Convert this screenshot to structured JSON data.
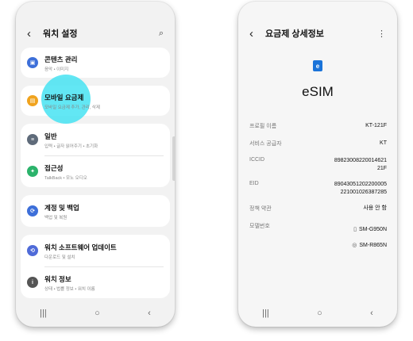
{
  "left_phone": {
    "header": {
      "title": "워치 설정"
    },
    "items": [
      {
        "title": "콘텐츠 관리",
        "subtitle": "음악 • 이미지",
        "color": "#3d6fd9",
        "glyph": "▣"
      },
      {
        "title": "모바일 요금제",
        "subtitle": "모바일 요금제 추가, 관리, 삭제",
        "color": "#f0a31e",
        "glyph": "▤"
      },
      {
        "title": "일반",
        "subtitle": "입력 • 글자 읽어주기 • 초기화",
        "color": "#5f6b7a",
        "glyph": "≡"
      },
      {
        "title": "접근성",
        "subtitle": "TalkBack • 모노 오디오",
        "color": "#2bb36b",
        "glyph": "✦"
      },
      {
        "title": "계정 및 백업",
        "subtitle": "백업 및 복원",
        "color": "#3d6fd9",
        "glyph": "⟳"
      },
      {
        "title": "워치 소프트웨어 업데이트",
        "subtitle": "다운로드 및 설치",
        "color": "#4f6bd8",
        "glyph": "⟲"
      },
      {
        "title": "워치 정보",
        "subtitle": "상태 • 법률 정보 • 워치 이름",
        "color": "#555555",
        "glyph": "ⓘ"
      }
    ]
  },
  "right_phone": {
    "header": {
      "title": "요금제 상세정보"
    },
    "esim_icon_letter": "e",
    "esim_title": "eSIM",
    "rows": [
      {
        "label": "프로필 이름",
        "value": "KT-121F"
      },
      {
        "label": "서비스 공급자",
        "value": "KT"
      },
      {
        "label": "ICCID",
        "value_line1": "89823008220014621",
        "value_line2": "21F"
      },
      {
        "label": "EID",
        "value_line1": "89043051202200005",
        "value_line2": "221001026387285"
      },
      {
        "label": "정책 약관",
        "value": "사용 안 함"
      },
      {
        "label": "모델번호",
        "value_line1": "SM-G950N",
        "value_line2": "SM-R865N"
      }
    ]
  }
}
